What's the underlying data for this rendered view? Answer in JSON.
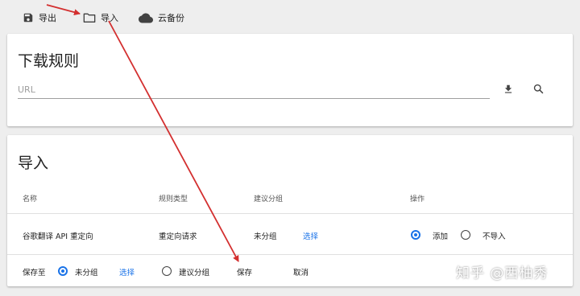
{
  "toolbar": {
    "export_label": "导出",
    "import_label": "导入",
    "cloud_backup_label": "云备份"
  },
  "rules_card": {
    "title": "下载规则",
    "url_placeholder": "URL"
  },
  "import_card": {
    "title": "导入",
    "columns": [
      "名称",
      "规则类型",
      "建议分组",
      "操作"
    ],
    "row": {
      "name": "谷歌翻译 API 重定向",
      "type": "重定向请求",
      "group": "未分组",
      "select_label": "选择",
      "action_add": "添加",
      "action_skip": "不导入",
      "selected_action": "添加"
    },
    "footer": {
      "save_to_label": "保存至",
      "option_ungrouped": "未分组",
      "select_label": "选择",
      "option_suggested": "建议分组",
      "selected_option": "未分组",
      "save_label": "保存",
      "cancel_label": "取消"
    }
  },
  "watermark": "知乎 @西柚秀",
  "colors": {
    "accent": "#1a73e8",
    "annotation_arrow": "#d32f2f",
    "background": "#eeeeee"
  }
}
